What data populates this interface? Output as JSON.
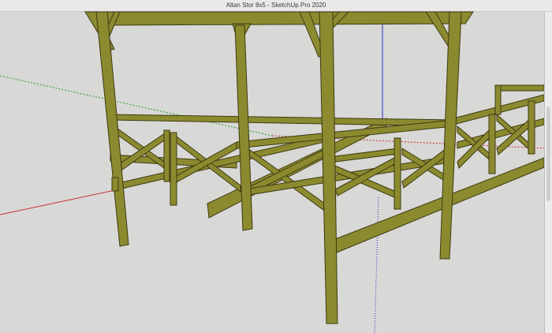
{
  "window": {
    "title": "Altan Stor 8x5 - SketchUp Pro 2020"
  },
  "colors": {
    "wood": "#8c8a2f",
    "wood_dark": "#4b4a17",
    "background": "#d8d8d6",
    "axis_red": "#c33",
    "axis_green": "#2a9b2a",
    "axis_blue": "#2a2ad0"
  }
}
